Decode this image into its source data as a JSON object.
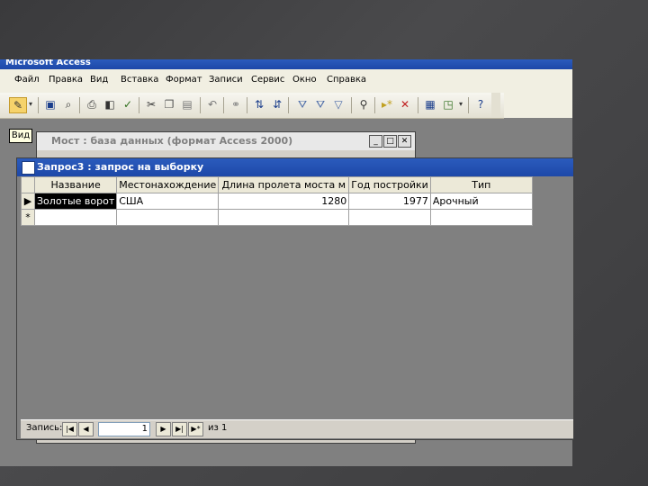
{
  "app": {
    "title": "Microsoft Access"
  },
  "menu": [
    "Файл",
    "Правка",
    "Вид",
    "Вставка",
    "Формат",
    "Записи",
    "Сервис",
    "Окно",
    "Справка"
  ],
  "tooltip": "Вид",
  "db_window": {
    "title": "Мост : база данных (формат Access 2000)"
  },
  "query_window": {
    "title": "Запрос3 : запрос на выборку",
    "columns": [
      "Название",
      "Местонахождение",
      "Длина пролета моста м",
      "Год постройки",
      "Тип"
    ],
    "rows": [
      {
        "name": "Золотые ворот",
        "location": "США",
        "span": "1280",
        "year": "1977",
        "type": "Арочный"
      }
    ],
    "new_row_marker": "*",
    "current_row_marker": "▶"
  },
  "navigation": {
    "label": "Запись:",
    "current": "1",
    "of_label": "из 1"
  },
  "icons": [
    "view-icon",
    "save-icon",
    "print-icon",
    "preview-icon",
    "spell-icon",
    "cut-icon",
    "copy-icon",
    "paste-icon",
    "undo-icon",
    "sort-asc-icon",
    "sort-desc-icon",
    "filter-icon",
    "find-icon",
    "new-record-icon",
    "delete-record-icon",
    "database-window-icon",
    "new-object-icon",
    "help-icon"
  ]
}
